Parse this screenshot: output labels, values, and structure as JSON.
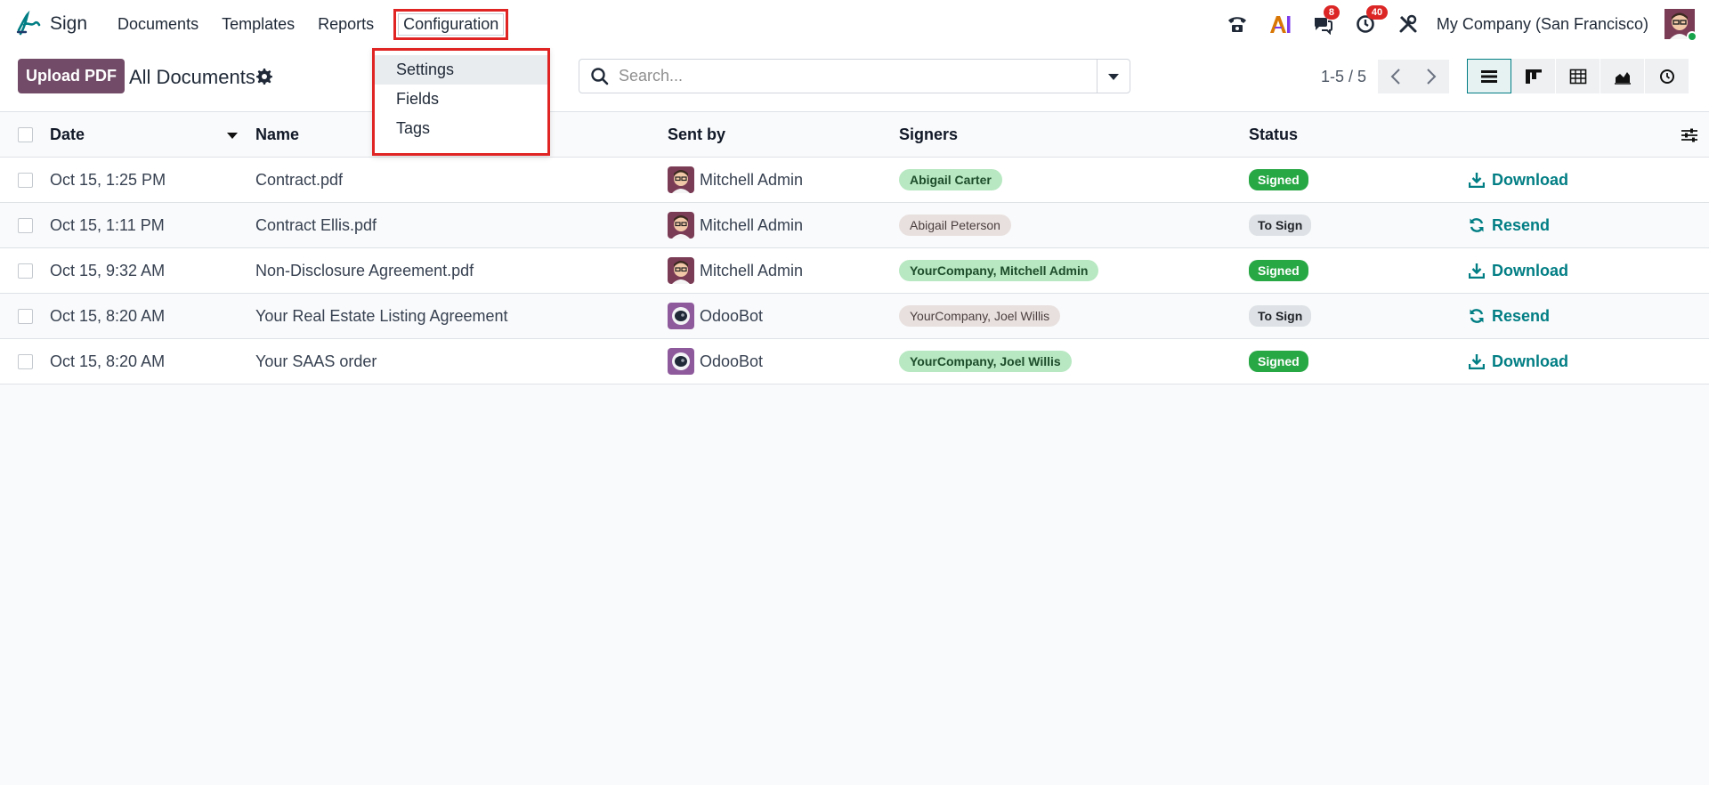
{
  "navbar": {
    "app_name": "Sign",
    "menu": [
      {
        "label": "Documents"
      },
      {
        "label": "Templates"
      },
      {
        "label": "Reports"
      },
      {
        "label": "Configuration"
      }
    ],
    "badges": {
      "messages": "8",
      "activities": "40"
    },
    "company": "My Company (San Francisco)"
  },
  "configuration_dropdown": [
    {
      "label": "Settings"
    },
    {
      "label": "Fields"
    },
    {
      "label": "Tags"
    }
  ],
  "control_panel": {
    "upload_label": "Upload PDF",
    "view_title": "All Documents",
    "search_placeholder": "Search...",
    "pager": "1-5 / 5"
  },
  "table": {
    "columns": {
      "date": "Date",
      "name": "Name",
      "sent_by": "Sent by",
      "signers": "Signers",
      "status": "Status"
    },
    "rows": [
      {
        "date": "Oct 15, 1:25 PM",
        "name": "Contract.pdf",
        "sent_by": "Mitchell Admin",
        "signers": "Abigail Carter",
        "status": "Signed",
        "action": "Download"
      },
      {
        "date": "Oct 15, 1:11 PM",
        "name": "Contract Ellis.pdf",
        "sent_by": "Mitchell Admin",
        "signers": "Abigail Peterson",
        "status": "To Sign",
        "action": "Resend"
      },
      {
        "date": "Oct 15, 9:32 AM",
        "name": "Non-Disclosure Agreement.pdf",
        "sent_by": "Mitchell Admin",
        "signers": "YourCompany, Mitchell Admin",
        "status": "Signed",
        "action": "Download"
      },
      {
        "date": "Oct 15, 8:20 AM",
        "name": "Your Real Estate Listing Agreement",
        "sent_by": "OdooBot",
        "signers": "YourCompany, Joel Willis",
        "status": "To Sign",
        "action": "Resend"
      },
      {
        "date": "Oct 15, 8:20 AM",
        "name": "Your SAAS order",
        "sent_by": "OdooBot",
        "signers": "YourCompany, Joel Willis",
        "status": "Signed",
        "action": "Download"
      }
    ]
  },
  "colors": {
    "brand": "#714b67",
    "accent": "#017e84",
    "highlight": "#e02424",
    "signed": "#28a745"
  }
}
